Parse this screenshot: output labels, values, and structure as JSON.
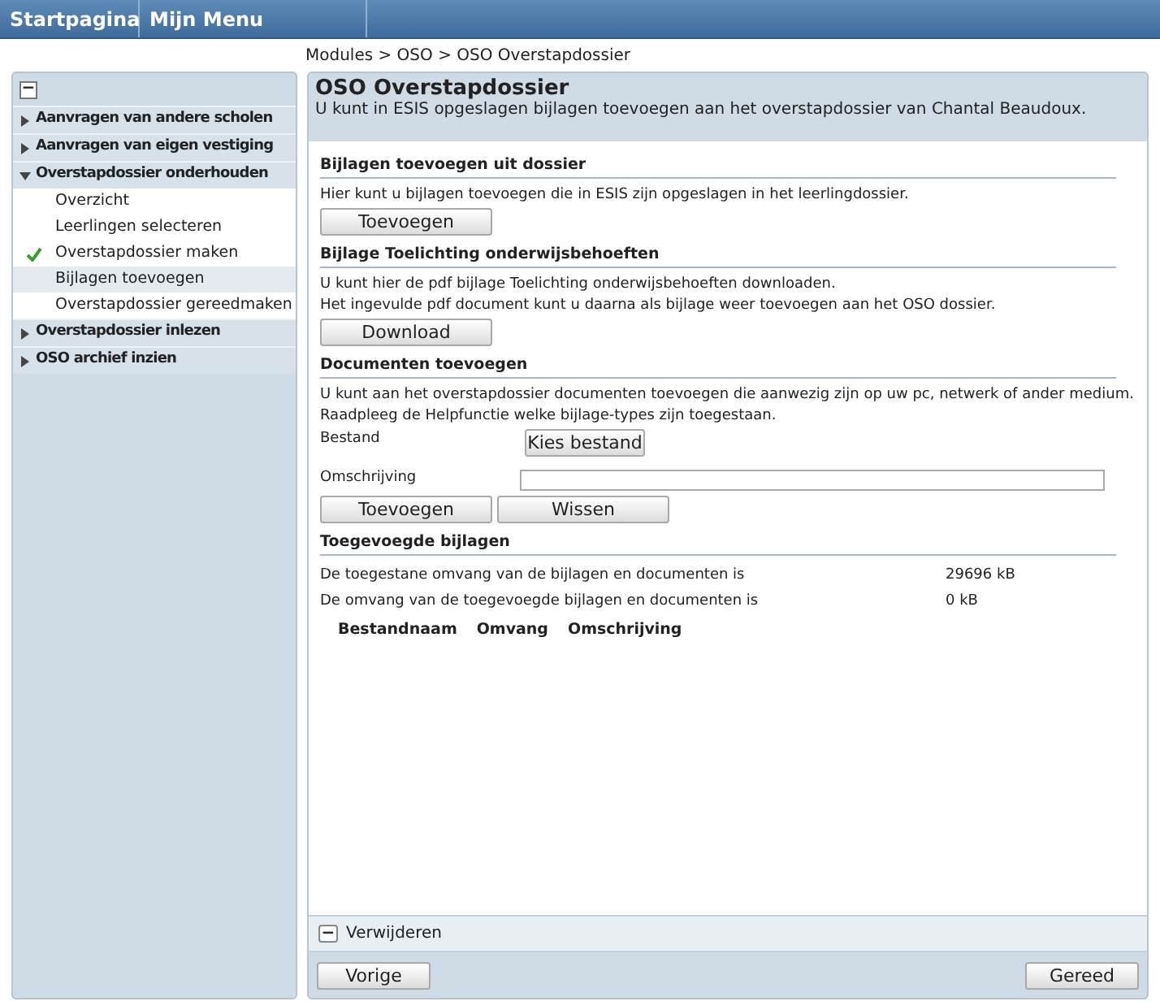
{
  "top_menu": [
    {
      "label": "Startpagina"
    },
    {
      "label": "Mijn Menu"
    }
  ],
  "breadcrumb": "Modules > OSO > OSO Overstapdossier",
  "sidebar": {
    "collapse_symbol": "−",
    "groups": [
      {
        "label": "Aanvragen van andere scholen",
        "expanded": false
      },
      {
        "label": "Aanvragen van eigen vestiging",
        "expanded": false
      },
      {
        "label": "Overstapdossier onderhouden",
        "expanded": true,
        "children": [
          {
            "label": "Overzicht",
            "selected": false,
            "checked": false
          },
          {
            "label": "Leerlingen selecteren",
            "selected": false,
            "checked": false
          },
          {
            "label": "Overstapdossier maken",
            "selected": false,
            "checked": true
          },
          {
            "label": "Bijlagen toevoegen",
            "selected": true,
            "checked": false
          },
          {
            "label": "Overstapdossier gereedmaken",
            "selected": false,
            "checked": false
          }
        ]
      },
      {
        "label": "Overstapdossier inlezen",
        "expanded": false
      },
      {
        "label": "OSO archief inzien",
        "expanded": false
      }
    ]
  },
  "panel": {
    "title": "OSO Overstapdossier",
    "subtitle": "U kunt in ESIS opgeslagen bijlagen toevoegen aan het overstapdossier van Chantal Beaudoux.",
    "sections": [
      {
        "heading": "Bijlagen toevoegen uit dossier",
        "lines": [
          "Hier kunt u bijlagen toevoegen die in ESIS zijn opgeslagen in het leerlingdossier."
        ],
        "button": "Toevoegen"
      },
      {
        "heading": "Bijlage Toelichting onderwijsbehoeften",
        "lines": [
          "U kunt hier de pdf bijlage Toelichting onderwijsbehoeften downloaden.",
          "Het ingevulde pdf document kunt u daarna als bijlage weer toevoegen aan het OSO dossier."
        ],
        "button": "Download"
      },
      {
        "heading": "Documenten toevoegen",
        "lines": [
          "U kunt aan het overstapdossier documenten toevoegen die aanwezig zijn op uw pc, netwerk of ander medium.",
          "Raadpleeg de Helpfunctie welke bijlage-types zijn toegestaan."
        ]
      }
    ],
    "file_label": "Bestand",
    "file_button": "Kies bestand",
    "description_label": "Omschrijving",
    "form_buttons": [
      "Toevoegen",
      "Wissen"
    ],
    "attachments": {
      "heading": "Toegevoegde bijlagen",
      "rows": [
        {
          "label": "De toegestane omvang van de bijlagen en documenten is",
          "value": "29696 kB"
        },
        {
          "label": "De omvang van de toegevoegde bijlagen en documenten is",
          "value": "0 kB"
        }
      ],
      "columns": [
        "Bestandnaam",
        "Omvang",
        "Omschrijving"
      ]
    },
    "remove": {
      "symbol": "−",
      "label": "Verwijderen"
    },
    "back_button": "Vorige",
    "done_button": "Gereed"
  }
}
